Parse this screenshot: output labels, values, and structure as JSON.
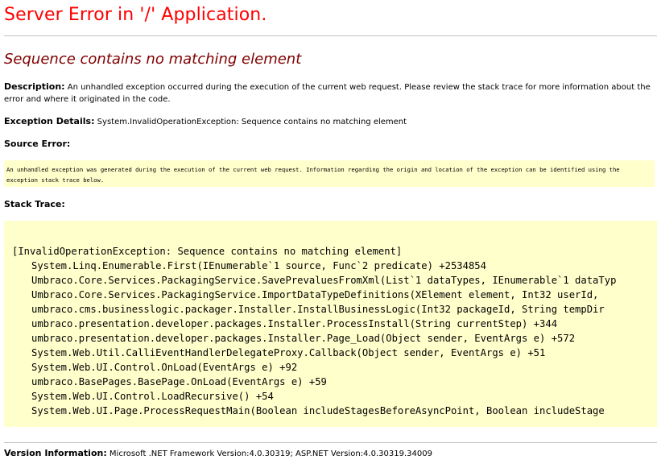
{
  "title": "Server Error in '/' Application.",
  "subtitle": "Sequence contains no matching element",
  "description": {
    "label": "Description:",
    "text": "An unhandled exception occurred during the execution of the current web request. Please review the stack trace for more information about the error and where it originated in the code."
  },
  "exception_details": {
    "label": "Exception Details:",
    "text": "System.InvalidOperationException: Sequence contains no matching element"
  },
  "source_error": {
    "heading": "Source Error:",
    "text": "An unhandled exception was generated during the execution of the current web request. Information regarding the origin and location of the exception can be identified using the exception stack trace below."
  },
  "stack_trace": {
    "heading": "Stack Trace:",
    "lines": [
      "[InvalidOperationException: Sequence contains no matching element]",
      "System.Linq.Enumerable.First(IEnumerable`1 source, Func`2 predicate) +2534854",
      "Umbraco.Core.Services.PackagingService.SavePrevaluesFromXml(List`1 dataTypes, IEnumerable`1 dataTyp",
      "Umbraco.Core.Services.PackagingService.ImportDataTypeDefinitions(XElement element, Int32 userId, ",
      "umbraco.cms.businesslogic.packager.Installer.InstallBusinessLogic(Int32 packageId, String tempDir",
      "umbraco.presentation.developer.packages.Installer.ProcessInstall(String currentStep) +344",
      "umbraco.presentation.developer.packages.Installer.Page_Load(Object sender, EventArgs e) +572",
      "System.Web.Util.CalliEventHandlerDelegateProxy.Callback(Object sender, EventArgs e) +51",
      "System.Web.UI.Control.OnLoad(EventArgs e) +92",
      "umbraco.BasePages.BasePage.OnLoad(EventArgs e) +59",
      "System.Web.UI.Control.LoadRecursive() +54",
      "System.Web.UI.Page.ProcessRequestMain(Boolean includeStagesBeforeAsyncPoint, Boolean includeStage"
    ]
  },
  "version_information": {
    "label": "Version Information:",
    "text": "Microsoft .NET Framework Version:4.0.30319; ASP.NET Version:4.0.30319.34009"
  },
  "colors": {
    "title": "#ff0000",
    "subtitle": "#800000",
    "code_background": "#ffffcc",
    "rule": "#c0c0c0"
  }
}
